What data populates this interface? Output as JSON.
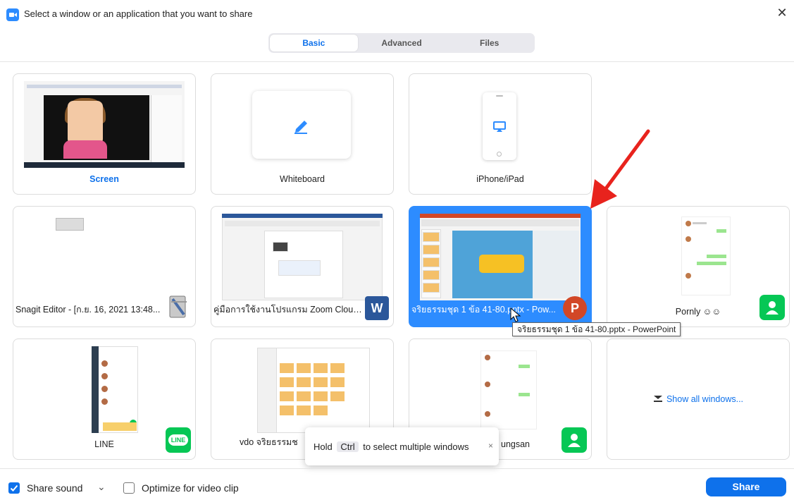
{
  "window": {
    "title": "Select a window or an application that you want to share",
    "close_symbol": "✕"
  },
  "tabs": [
    {
      "label": "Basic",
      "active": true
    },
    {
      "label": "Advanced",
      "active": false
    },
    {
      "label": "Files",
      "active": false
    }
  ],
  "tiles": [
    {
      "label": "Screen"
    },
    {
      "label": "Whiteboard"
    },
    {
      "label": "iPhone/iPad"
    },
    {
      "label": "Snagit Editor - [ก.ย. 16, 2021 13:48..."
    },
    {
      "label": "คู่มือการใช้งานโปรแกรม Zoom Cloud..."
    },
    {
      "label": "จริยธรรมชุด 1 ข้อ 41-80.pptx - Pow..."
    },
    {
      "label": "Pornly ☺☺"
    },
    {
      "label": "LINE"
    },
    {
      "label": "vdo จริยธรรมช"
    },
    {
      "label": "ungsan"
    },
    {
      "label": "Show all windows..."
    }
  ],
  "badges": {
    "word": "W",
    "powerpoint": "P",
    "line": "LINE"
  },
  "tooltip": "จริยธรรมชุด 1 ข้อ 41-80.pptx - PowerPoint",
  "hint": {
    "prefix": "Hold",
    "key": "Ctrl",
    "suffix": "to select multiple windows",
    "close": "×"
  },
  "bottom": {
    "share_sound": {
      "label": "Share sound",
      "checked": true
    },
    "dropdown_symbol": "⌄",
    "optimize_video": {
      "label": "Optimize for video clip",
      "checked": false
    },
    "share_button": "Share"
  },
  "colors": {
    "accent": "#0E71EB",
    "selected_tile": "#2D8CFF",
    "line_green": "#06C755",
    "powerpoint": "#D24726",
    "word": "#2B579A",
    "arrow": "#E8231D"
  },
  "icons": [
    "zoom-app-icon",
    "close-icon",
    "pen-icon",
    "airplay-icon",
    "word-icon",
    "powerpoint-icon",
    "line-icon",
    "contact-icon",
    "show-all-windows-icon",
    "checkbox-icon",
    "chevron-down-icon",
    "red-arrow-annotation"
  ]
}
